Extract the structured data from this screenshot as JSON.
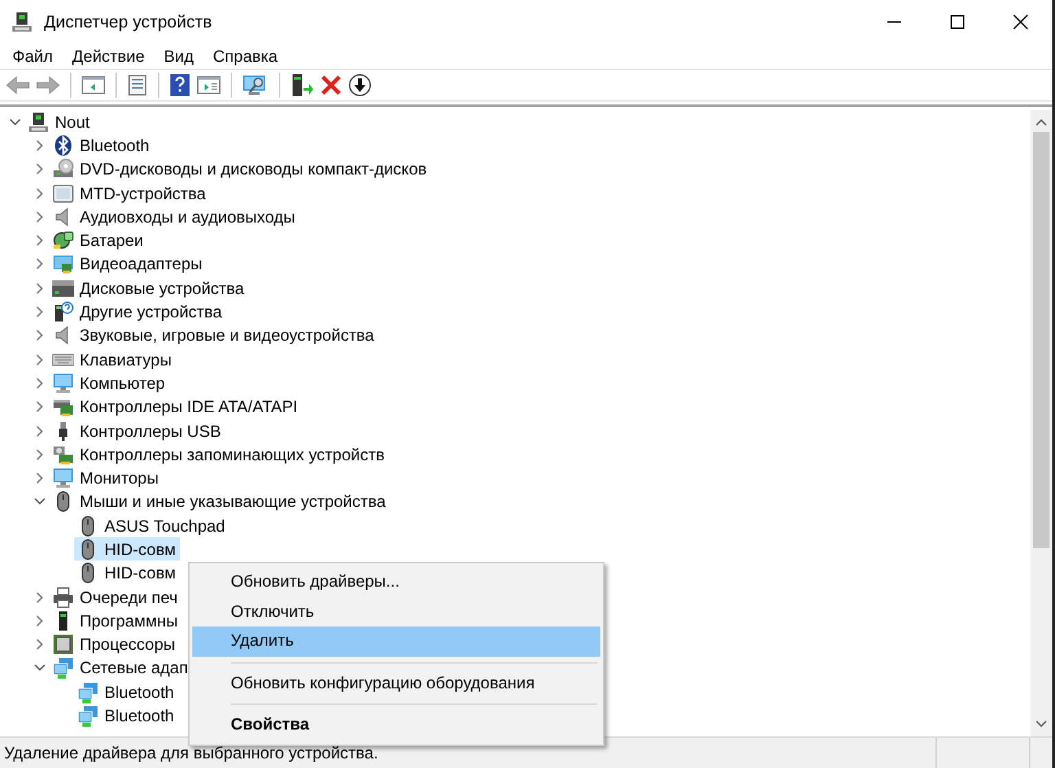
{
  "window": {
    "title": "Диспетчер устройств"
  },
  "menu_bar": [
    {
      "label": "Файл"
    },
    {
      "label": "Действие"
    },
    {
      "label": "Вид"
    },
    {
      "label": "Справка"
    }
  ],
  "toolbar": [
    {
      "kind": "back",
      "disabled": true
    },
    {
      "kind": "forward",
      "disabled": true
    },
    {
      "kind": "separator"
    },
    {
      "kind": "console-tree",
      "disabled": false
    },
    {
      "kind": "separator"
    },
    {
      "kind": "properties",
      "disabled": false
    },
    {
      "kind": "separator"
    },
    {
      "kind": "help",
      "disabled": false
    },
    {
      "kind": "action-pane",
      "disabled": false
    },
    {
      "kind": "separator"
    },
    {
      "kind": "scan",
      "disabled": false
    },
    {
      "kind": "separator"
    },
    {
      "kind": "update-driver",
      "disabled": false
    },
    {
      "kind": "uninstall",
      "disabled": false
    },
    {
      "kind": "disable",
      "disabled": false
    }
  ],
  "tree": {
    "label": "Nout",
    "expanded": true,
    "selected": false,
    "children": [
      {
        "label": "Bluetooth",
        "expanded": false,
        "selected": false
      },
      {
        "label": "DVD-дисководы и дисководы компакт-дисков",
        "expanded": false,
        "selected": false
      },
      {
        "label": "MTD-устройства",
        "expanded": false,
        "selected": false
      },
      {
        "label": "Аудиовходы и аудиовыходы",
        "expanded": false,
        "selected": false
      },
      {
        "label": "Батареи",
        "expanded": false,
        "selected": false
      },
      {
        "label": "Видеоадаптеры",
        "expanded": false,
        "selected": false
      },
      {
        "label": "Дисковые устройства",
        "expanded": false,
        "selected": false
      },
      {
        "label": "Другие устройства",
        "expanded": false,
        "selected": false
      },
      {
        "label": "Звуковые, игровые и видеоустройства",
        "expanded": false,
        "selected": false
      },
      {
        "label": "Клавиатуры",
        "expanded": false,
        "selected": false
      },
      {
        "label": "Компьютер",
        "expanded": false,
        "selected": false
      },
      {
        "label": "Контроллеры IDE ATA/ATAPI",
        "expanded": false,
        "selected": false
      },
      {
        "label": "Контроллеры USB",
        "expanded": false,
        "selected": false
      },
      {
        "label": "Контроллеры запоминающих устройств",
        "expanded": false,
        "selected": false
      },
      {
        "label": "Мониторы",
        "expanded": false,
        "selected": false
      },
      {
        "label": "Мыши и иные указывающие устройства",
        "expanded": true,
        "selected": false,
        "children": [
          {
            "label": "ASUS Touchpad",
            "selected": false
          },
          {
            "label": "HID-совм",
            "selected": true
          },
          {
            "label": "HID-совм",
            "selected": false
          }
        ]
      },
      {
        "label": "Очереди печ",
        "expanded": false,
        "selected": false
      },
      {
        "label": "Программны",
        "expanded": false,
        "selected": false
      },
      {
        "label": "Процессоры",
        "expanded": false,
        "selected": false
      },
      {
        "label": "Сетевые адап",
        "expanded": true,
        "selected": false,
        "children": [
          {
            "label": "Bluetooth",
            "selected": false
          },
          {
            "label": "Bluetooth",
            "selected": false
          }
        ]
      }
    ]
  },
  "context_menu": {
    "groups": [
      [
        {
          "label": "Обновить драйверы...",
          "selected": false,
          "default": false
        },
        {
          "label": "Отключить",
          "selected": false,
          "default": false
        },
        {
          "label": "Удалить",
          "selected": true,
          "default": false
        }
      ],
      [
        {
          "label": "Обновить конфигурацию оборудования",
          "selected": false,
          "default": false
        }
      ],
      [
        {
          "label": "Свойства",
          "selected": false,
          "default": true
        }
      ]
    ]
  },
  "status_bar": {
    "text": "Удаление драйвера для выбранного устройства."
  }
}
